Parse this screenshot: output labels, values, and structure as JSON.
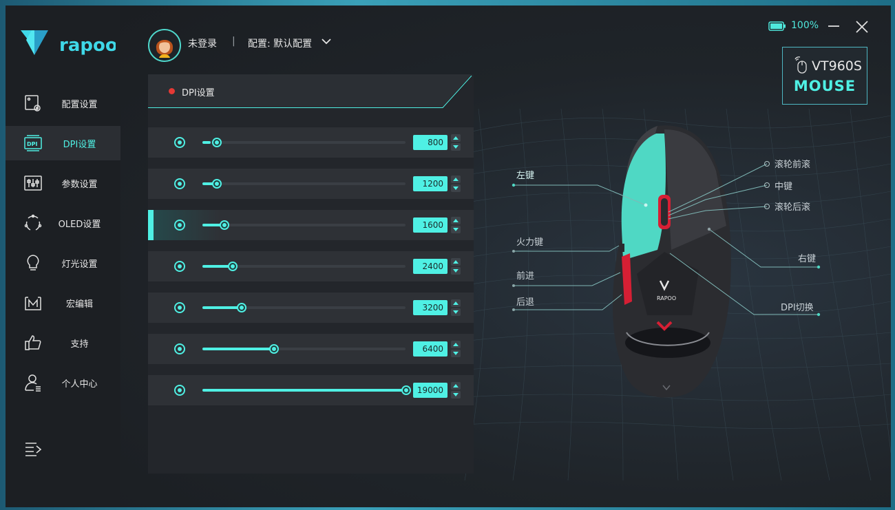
{
  "brand": {
    "logo_text": "rapoo"
  },
  "header": {
    "login_status": "未登录",
    "separator": "|",
    "profile_label": "配置: 默认配置",
    "battery_level": 1.0,
    "battery_text": "100%"
  },
  "device": {
    "model": "VT960S",
    "type": "MOUSE"
  },
  "sidebar": {
    "items": [
      {
        "label": "配置设置",
        "icon": "profile-settings-icon",
        "active": false
      },
      {
        "label": "DPI设置",
        "icon": "dpi-icon",
        "active": true
      },
      {
        "label": "参数设置",
        "icon": "sliders-icon",
        "active": false
      },
      {
        "label": "OLED设置",
        "icon": "oled-icon",
        "active": false
      },
      {
        "label": "灯光设置",
        "icon": "lightbulb-icon",
        "active": false
      },
      {
        "label": "宏编辑",
        "icon": "macro-icon",
        "active": false
      },
      {
        "label": "支持",
        "icon": "thumbs-up-icon",
        "active": false
      },
      {
        "label": "个人中心",
        "icon": "user-icon",
        "active": false
      }
    ],
    "menu_icon": "menu-collapse-icon"
  },
  "dpi_panel": {
    "title": "DPI设置",
    "rows": [
      {
        "value": "800",
        "level": 0.042,
        "selected": false
      },
      {
        "value": "1200",
        "level": 0.063,
        "selected": false
      },
      {
        "value": "1600",
        "level": 0.105,
        "selected": true
      },
      {
        "value": "2400",
        "level": 0.147,
        "selected": false
      },
      {
        "value": "3200",
        "level": 0.19,
        "selected": false
      },
      {
        "value": "6400",
        "level": 0.35,
        "selected": false
      },
      {
        "value": "19000",
        "level": 1.0,
        "selected": false
      }
    ]
  },
  "mouse_labels": {
    "left_button": "左键",
    "fire_key": "火力键",
    "forward": "前进",
    "back": "后退",
    "scroll_up": "滚轮前滚",
    "middle": "中键",
    "scroll_down": "滚轮后滚",
    "right_button": "右键",
    "dpi_switch": "DPI切换"
  },
  "colors": {
    "accent": "#4ff0e4",
    "status_dot": "#e53935",
    "mouse_teal": "#4fd8c4",
    "mouse_red": "#e0243a"
  }
}
